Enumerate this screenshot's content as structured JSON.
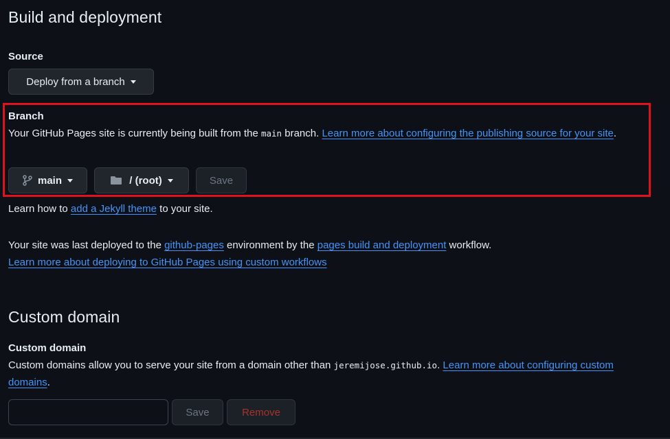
{
  "build": {
    "title": "Build and deployment",
    "source_label": "Source",
    "source_dropdown": "Deploy from a branch"
  },
  "branch": {
    "label": "Branch",
    "desc_prefix": "Your GitHub Pages site is currently being built from the ",
    "desc_branch": "main",
    "desc_suffix": " branch. ",
    "desc_link": "Learn more about configuring the publishing source for your site",
    "desc_end": ".",
    "branch_button": "main",
    "folder_button": "/ (root)",
    "save_button": "Save",
    "highlight_color": "#e0121b"
  },
  "theme": {
    "prefix": "Learn how to ",
    "link": "add a Jekyll theme",
    "suffix": " to your site."
  },
  "deployed": {
    "prefix": "Your site was last deployed to the ",
    "env_link": "github-pages",
    "middle": " environment by the ",
    "workflow_link": "pages build and deployment",
    "suffix": " workflow.",
    "custom_workflows_link": "Learn more about deploying to GitHub Pages using custom workflows"
  },
  "custom_domain": {
    "title": "Custom domain",
    "label": "Custom domain",
    "desc_prefix": "Custom domains allow you to serve your site from a domain other than ",
    "desc_domain": "jeremijose.github.io",
    "desc_suffix": ". ",
    "desc_link": "Learn more about configuring custom domains",
    "desc_end": ".",
    "input_value": "",
    "save_button": "Save",
    "remove_button": "Remove"
  },
  "colors": {
    "background": "#0d1117",
    "link": "#4493f8",
    "button_bg": "#21262d",
    "danger": "#a6332e"
  }
}
